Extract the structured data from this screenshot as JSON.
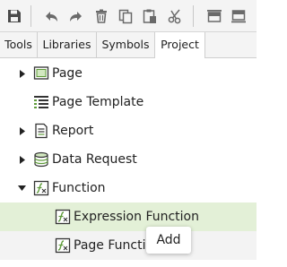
{
  "toolbar": {
    "buttons": [
      "save-icon",
      "undo-icon",
      "redo-icon",
      "delete-icon",
      "copy-icon",
      "paste-icon",
      "cut-icon",
      "align-top-icon",
      "align-bottom-icon"
    ]
  },
  "tabs": [
    {
      "label": "Tools",
      "active": false
    },
    {
      "label": "Libraries",
      "active": false
    },
    {
      "label": "Symbols",
      "active": false
    },
    {
      "label": "Project",
      "active": true
    }
  ],
  "tree": {
    "items": [
      {
        "label": "Page",
        "icon": "page-icon",
        "expander": "collapsed"
      },
      {
        "label": "Page Template",
        "icon": "page-template-icon",
        "expander": "none"
      },
      {
        "label": "Report",
        "icon": "report-icon",
        "expander": "collapsed"
      },
      {
        "label": "Data Request",
        "icon": "data-request-icon",
        "expander": "collapsed"
      },
      {
        "label": "Function",
        "icon": "function-icon",
        "expander": "expanded"
      },
      {
        "label": "Expression Function",
        "icon": "function-icon",
        "expander": "none",
        "state": "selected"
      },
      {
        "label": "Page Function",
        "icon": "function-icon",
        "expander": "none",
        "state": "hover"
      }
    ]
  },
  "context_menu": {
    "items": [
      "Add"
    ]
  },
  "colors": {
    "toolbar_icon": "#4a4a4a",
    "selected_row": "#e3f0d7",
    "hover_row": "#f3f3f3",
    "icon_green": "#5f9b3a"
  }
}
